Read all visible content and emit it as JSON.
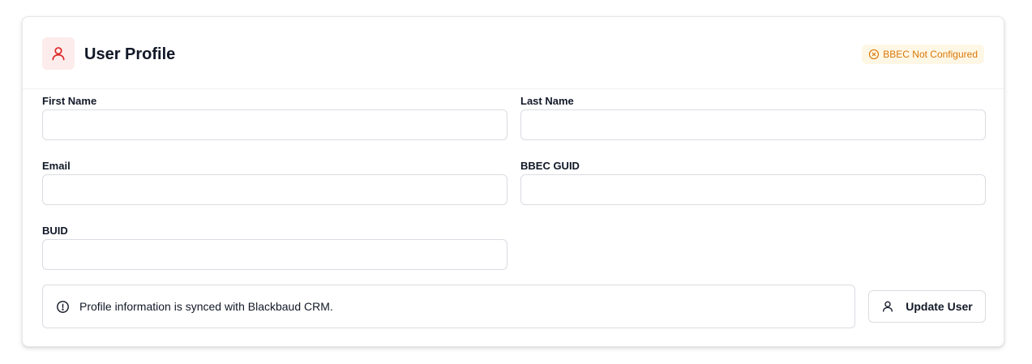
{
  "header": {
    "title": "User Profile",
    "avatar_icon": "user-icon",
    "badge": {
      "label": "BBEC Not Configured",
      "icon": "x-circle-icon",
      "color": "#d97706",
      "background": "#fff7e6"
    }
  },
  "fields": {
    "first_name": {
      "label": "First Name",
      "value": ""
    },
    "last_name": {
      "label": "Last Name",
      "value": ""
    },
    "email": {
      "label": "Email",
      "value": ""
    },
    "bbec_guid": {
      "label": "BBEC GUID",
      "value": ""
    },
    "buid": {
      "label": "BUID",
      "value": ""
    }
  },
  "info": {
    "icon": "alert-circle-icon",
    "text": "Profile information is synced with Blackbaud CRM."
  },
  "actions": {
    "update_label": "Update User",
    "update_icon": "user-icon"
  },
  "colors": {
    "accent": "#dc2626",
    "accent_bg": "#fdecec",
    "border": "#d9dce1"
  }
}
